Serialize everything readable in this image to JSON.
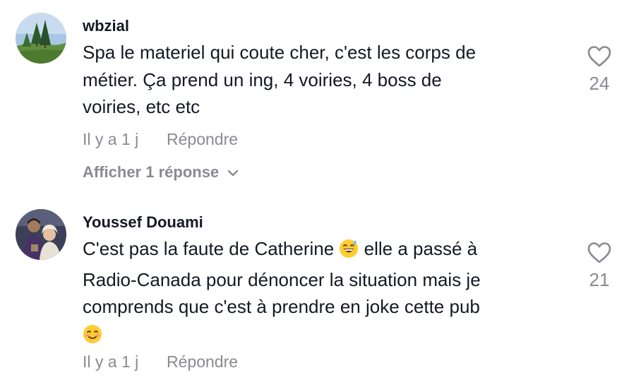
{
  "comments": [
    {
      "username": "wbzial",
      "lines": [
        "Spa le materiel qui coute cher, c'est les corps de",
        "métier. Ça prend un ing, 4 voiries, 4 boss de",
        "voiries, etc etc"
      ],
      "time": "Il y a 1 j",
      "reply_label": "Répondre",
      "view_replies_label": "Afficher 1 réponse",
      "likes": "24",
      "avatar_icon": "landscape-trees-avatar"
    },
    {
      "username": "Youssef Douami",
      "lines": [
        "C'est pas la faute de Catherine",
        "elle a passé à",
        "Radio-Canada pour dénoncer la situation mais je",
        "comprends que c'est à prendre en joke cette pub"
      ],
      "emoji_1": "grinning-face-with-sweat-emoji",
      "emoji_2": "smiling-face-emoji",
      "time": "Il y a 1 j",
      "reply_label": "Répondre",
      "likes": "21",
      "avatar_icon": "two-people-photo-avatar"
    }
  ],
  "colors": {
    "text": "#161823",
    "muted": "#8a8b91"
  }
}
